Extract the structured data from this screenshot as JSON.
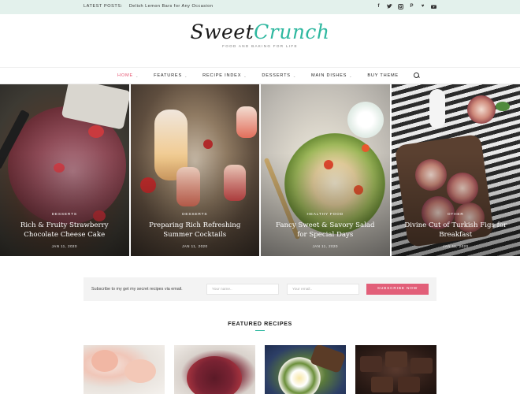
{
  "topbar": {
    "latest_label": "LATEST POSTS:",
    "latest_post": "Delish Lemon Bars for Any Occasion",
    "social_icons": [
      "facebook-icon",
      "twitter-icon",
      "instagram-icon",
      "pinterest-icon",
      "heart-icon",
      "youtube-icon"
    ]
  },
  "logo": {
    "word1": "Sweet",
    "word2": "Crunch",
    "tagline": "FOOD AND BAKING FOR LIFE",
    "accent_color": "#2fb8a0"
  },
  "nav": {
    "items": [
      {
        "label": "HOME",
        "active": true
      },
      {
        "label": "FEATURES",
        "dropdown": true
      },
      {
        "label": "RECIPE INDEX",
        "dropdown": true
      },
      {
        "label": "DESSERTS",
        "dropdown": true
      },
      {
        "label": "MAIN DISHES",
        "dropdown": true
      },
      {
        "label": "BUY THEME"
      }
    ],
    "active_color": "#e5506d"
  },
  "slides": [
    {
      "category": "DESSERTS",
      "title": "Rich & Fruity Strawberry Chocolate Cheese Cake",
      "date": "JAN 11, 2020"
    },
    {
      "category": "DESSERTS",
      "title": "Preparing Rich Refreshing Summer Cocktails",
      "date": "JAN 11, 2020"
    },
    {
      "category": "HEALTHY FOOD",
      "title": "Fancy Sweet & Savory Salad for Special Days",
      "date": "JAN 11, 2020"
    },
    {
      "category": "OTHER",
      "title": "Divine Cut of Turkish Figs for Breakfast",
      "date": "JAN 11, 2020"
    }
  ],
  "subscribe": {
    "text": "Subscribe to my get my secret recipes via email.",
    "name_placeholder": "Your name..",
    "email_placeholder": "Your email..",
    "button_label": "SUBSCRIBE NOW",
    "button_color": "#e25f79"
  },
  "featured": {
    "title": "FEATURED RECIPES"
  }
}
